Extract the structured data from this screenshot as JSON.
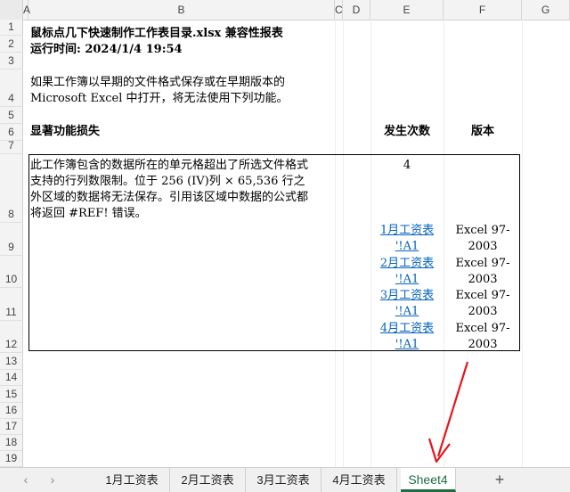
{
  "columns": [
    "A",
    "B",
    "C",
    "D",
    "E",
    "F",
    "G"
  ],
  "rows": [
    "1",
    "2",
    "3",
    "4",
    "5",
    "6",
    "7",
    "8",
    "9",
    "10",
    "11",
    "12",
    "13",
    "14",
    "15",
    "16",
    "17",
    "18",
    "19"
  ],
  "report": {
    "title": "鼠标点几下快速制作工作表目录.xlsx 兼容性报表",
    "runtime": "运行时间: 2024/1/4 19:54",
    "intro_line1": "如果工作簿以早期的文件格式保存或在早期版本的",
    "intro_line2": "Microsoft Excel 中打开，将无法使用下列功能。",
    "section_heading": "显著功能损失",
    "col_occurrences": "发生次数",
    "col_version": "版本",
    "issue_lines": [
      "此工作簿包含的数据所在的单元格超出了所选文件格式",
      "支持的行列数限制。位于 256 (IV)列 × 65,536 行之",
      "外区域的数据将无法保存。引用该区域中数据的公式都",
      "将返回 #REF! 错误。"
    ],
    "issue_count": "4",
    "refs": [
      {
        "link_line1": "1月工资表",
        "link_line2": "'!A1",
        "ver_line1": "Excel 97-",
        "ver_line2": "2003"
      },
      {
        "link_line1": "2月工资表",
        "link_line2": "'!A1",
        "ver_line1": "Excel 97-",
        "ver_line2": "2003"
      },
      {
        "link_line1": "3月工资表",
        "link_line2": "'!A1",
        "ver_line1": "Excel 97-",
        "ver_line2": "2003"
      },
      {
        "link_line1": "4月工资表",
        "link_line2": "'!A1",
        "ver_line1": "Excel 97-",
        "ver_line2": "2003"
      }
    ]
  },
  "tabs": {
    "prev": "‹",
    "next": "›",
    "sheets": [
      "1月工资表",
      "2月工资表",
      "3月工资表",
      "4月工资表",
      "Sheet4"
    ],
    "add": "+"
  },
  "colors": {
    "accent": "#1f6e43",
    "link": "#0563c1",
    "annotation": "#e8141b"
  }
}
